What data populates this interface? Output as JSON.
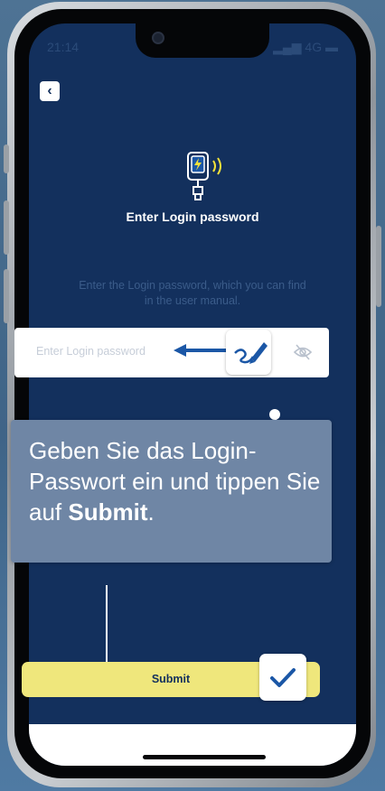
{
  "status_bar": {
    "time": "21:14",
    "network": "4G"
  },
  "header": {
    "back_icon": "chevron-left-icon"
  },
  "main": {
    "icon": "smart-device-icon",
    "title": "Enter Login password",
    "description": "Enter the Login password, which you can find in the user manual.",
    "password_field": {
      "placeholder": "Enter Login password",
      "toggle_icon": "eye-off-icon"
    }
  },
  "tutorial": {
    "callout_line1": "Geben Sie das Login-Passwort ein und tippen Sie auf ",
    "callout_bold": "Submit",
    "callout_end": ".",
    "pen_icon": "pen-icon",
    "arrow_icon": "arrow-left-icon",
    "check_icon": "checkmark-icon"
  },
  "footer": {
    "submit_label": "Submit"
  },
  "colors": {
    "screen_bg": "#13305d",
    "submit_bg": "#efe77c",
    "callout_bg": "#6f86a5",
    "accent": "#1b57a6"
  }
}
